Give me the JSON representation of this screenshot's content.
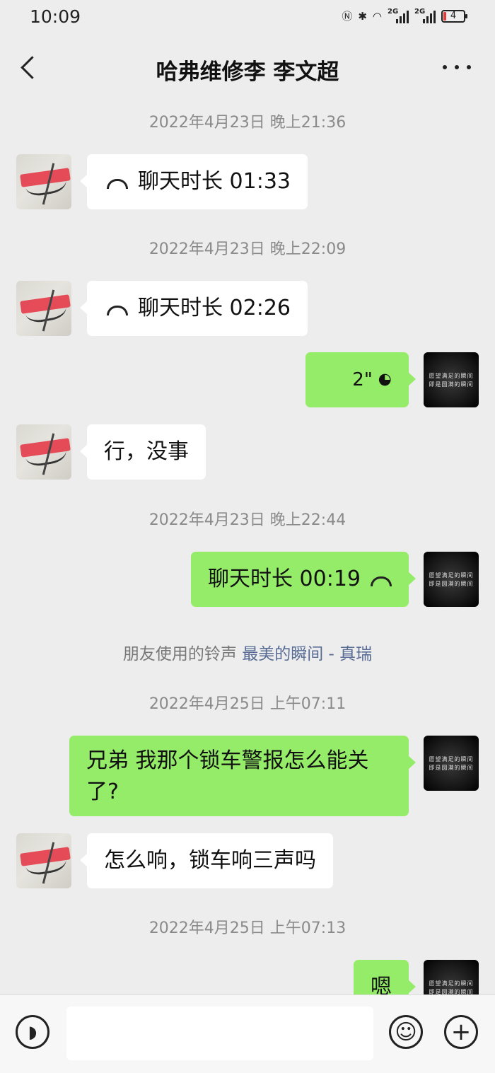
{
  "status_bar": {
    "time": "10:09",
    "network_1": "2G",
    "network_2": "2G",
    "battery": "4"
  },
  "header": {
    "title": "哈弗维修李  李文超"
  },
  "messages": {
    "ts1": "2022年4月23日 晚上21:36",
    "m1": "聊天时长 01:33",
    "ts2": "2022年4月23日 晚上22:09",
    "m2": "聊天时长 02:26",
    "m3_voice": "2\"",
    "m4": "行，没事",
    "ts3": "2022年4月23日 晚上22:44",
    "m5": "聊天时长 00:19",
    "ringtone_prefix": "朋友使用的铃声 ",
    "ringtone_link": "最美的瞬间 - 真瑞",
    "ts4": "2022年4月25日 上午07:11",
    "m6": "兄弟  我那个锁车警报怎么能关了?",
    "m7": "怎么响，锁车响三声吗",
    "ts5": "2022年4月25日 上午07:13",
    "m8": "嗯"
  },
  "avatar_text": {
    "line1": "愿望满足的瞬间",
    "line2": "即是圆满的瞬间"
  },
  "input": {
    "placeholder": ""
  },
  "icons": {
    "back": "back-arrow-icon",
    "more": "more-icon",
    "call": "phone-hangup-icon",
    "voice": "voice-wave-icon",
    "emoji": "emoji-icon",
    "plus": "plus-icon"
  }
}
